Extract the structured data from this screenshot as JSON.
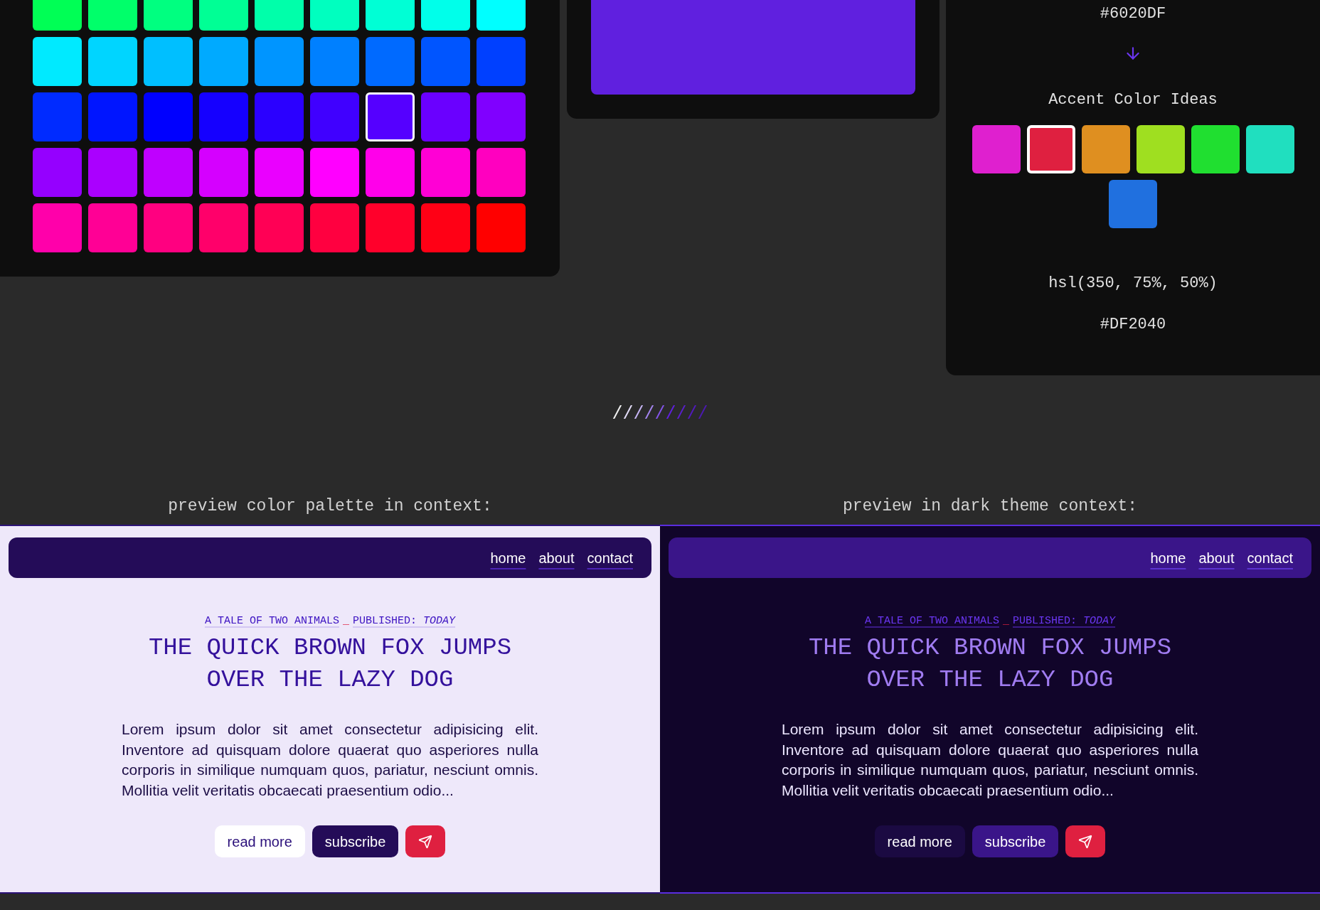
{
  "palette": {
    "swatches": [
      {
        "color": "#00ff55",
        "selected": false
      },
      {
        "color": "#00ff6a",
        "selected": false
      },
      {
        "color": "#00ff80",
        "selected": false
      },
      {
        "color": "#00ff95",
        "selected": false
      },
      {
        "color": "#00ffaa",
        "selected": false
      },
      {
        "color": "#00ffbf",
        "selected": false
      },
      {
        "color": "#00ffd5",
        "selected": false
      },
      {
        "color": "#00ffea",
        "selected": false
      },
      {
        "color": "#00ffff",
        "selected": false
      },
      {
        "color": "#00eaff",
        "selected": false
      },
      {
        "color": "#00d5ff",
        "selected": false
      },
      {
        "color": "#00bfff",
        "selected": false
      },
      {
        "color": "#00aaff",
        "selected": false
      },
      {
        "color": "#0095ff",
        "selected": false
      },
      {
        "color": "#0080ff",
        "selected": false
      },
      {
        "color": "#006aff",
        "selected": false
      },
      {
        "color": "#0055ff",
        "selected": false
      },
      {
        "color": "#0040ff",
        "selected": false
      },
      {
        "color": "#002bff",
        "selected": false
      },
      {
        "color": "#0015ff",
        "selected": false
      },
      {
        "color": "#0000ff",
        "selected": false
      },
      {
        "color": "#1500ff",
        "selected": false
      },
      {
        "color": "#2b00ff",
        "selected": false
      },
      {
        "color": "#4000ff",
        "selected": false
      },
      {
        "color": "#5500ff",
        "selected": true
      },
      {
        "color": "#6a00ff",
        "selected": false
      },
      {
        "color": "#8000ff",
        "selected": false
      },
      {
        "color": "#9500ff",
        "selected": false
      },
      {
        "color": "#aa00ff",
        "selected": false
      },
      {
        "color": "#bf00ff",
        "selected": false
      },
      {
        "color": "#d500ff",
        "selected": false
      },
      {
        "color": "#ea00ff",
        "selected": false
      },
      {
        "color": "#ff00ff",
        "selected": false
      },
      {
        "color": "#ff00ea",
        "selected": false
      },
      {
        "color": "#ff00d5",
        "selected": false
      },
      {
        "color": "#ff00bf",
        "selected": false
      },
      {
        "color": "#ff00aa",
        "selected": false
      },
      {
        "color": "#ff0095",
        "selected": false
      },
      {
        "color": "#ff0080",
        "selected": false
      },
      {
        "color": "#ff006a",
        "selected": false
      },
      {
        "color": "#ff0055",
        "selected": false
      },
      {
        "color": "#ff0040",
        "selected": false
      },
      {
        "color": "#ff002b",
        "selected": false
      },
      {
        "color": "#ff0015",
        "selected": false
      },
      {
        "color": "#ff0000",
        "selected": false
      }
    ]
  },
  "base_preview": {
    "color": "#6020df"
  },
  "accent_panel": {
    "base_hex": "#6020DF",
    "title": "Accent Color Ideas",
    "swatches": [
      {
        "color": "#df20cf",
        "selected": false
      },
      {
        "color": "#df2040",
        "selected": true
      },
      {
        "color": "#df8f20",
        "selected": false
      },
      {
        "color": "#9fdf20",
        "selected": false
      },
      {
        "color": "#20df30",
        "selected": false
      },
      {
        "color": "#20dfbf",
        "selected": false
      },
      {
        "color": "#2070df",
        "selected": false
      }
    ],
    "hsl": "hsl(350, 75%, 50%)",
    "hex": "#DF2040"
  },
  "shade_scale": [
    {
      "glyph": "/",
      "color": "#f2f2f2"
    },
    {
      "glyph": "/",
      "color": "#e4ddf8"
    },
    {
      "glyph": "/",
      "color": "#c7b5f5"
    },
    {
      "glyph": "/",
      "color": "#a585f0"
    },
    {
      "glyph": "/",
      "color": "#8454ea"
    },
    {
      "glyph": "/",
      "color": "#6020df"
    },
    {
      "glyph": "/",
      "color": "#5a1fcc"
    },
    {
      "glyph": "/",
      "color": "#521ac0"
    },
    {
      "glyph": "/",
      "color": "#4c19b3"
    }
  ],
  "previews": [
    {
      "kind": "light",
      "label": "preview color palette in context:",
      "nav": [
        "home",
        "about",
        "contact"
      ],
      "kicker": {
        "category": "A TALE OF TWO ANIMALS",
        "separator": "_",
        "published": "PUBLISHED: *TODAY*"
      },
      "headline": "THE QUICK BROWN FOX JUMPS OVER THE LAZY DOG",
      "body": "Lorem ipsum dolor sit amet consectetur adipisicing elit. Inventore ad quisquam dolore quaerat quo asperiores nulla corporis in similique numquam quos, pariatur, nesciunt omnis. Mollitia velit veritatis obcaecati praesentium odio...",
      "buttons": [
        {
          "kind": "secondary",
          "label": "read more"
        },
        {
          "kind": "primary",
          "label": "subscribe"
        },
        {
          "kind": "send"
        }
      ]
    },
    {
      "kind": "dark",
      "label": "preview in dark theme context:",
      "nav": [
        "home",
        "about",
        "contact"
      ],
      "kicker": {
        "category": "A TALE OF TWO ANIMALS",
        "separator": "_",
        "published": "PUBLISHED: *TODAY*"
      },
      "headline": "THE QUICK BROWN FOX JUMPS OVER THE LAZY DOG",
      "body": "Lorem ipsum dolor sit amet consectetur adipisicing elit. Inventore ad quisquam dolore quaerat quo asperiores nulla corporis in similique numquam quos, pariatur, nesciunt omnis. Mollitia velit veritatis obcaecati praesentium odio...",
      "buttons": [
        {
          "kind": "secondary",
          "label": "read more"
        },
        {
          "kind": "primary",
          "label": "subscribe"
        },
        {
          "kind": "send"
        }
      ]
    }
  ]
}
